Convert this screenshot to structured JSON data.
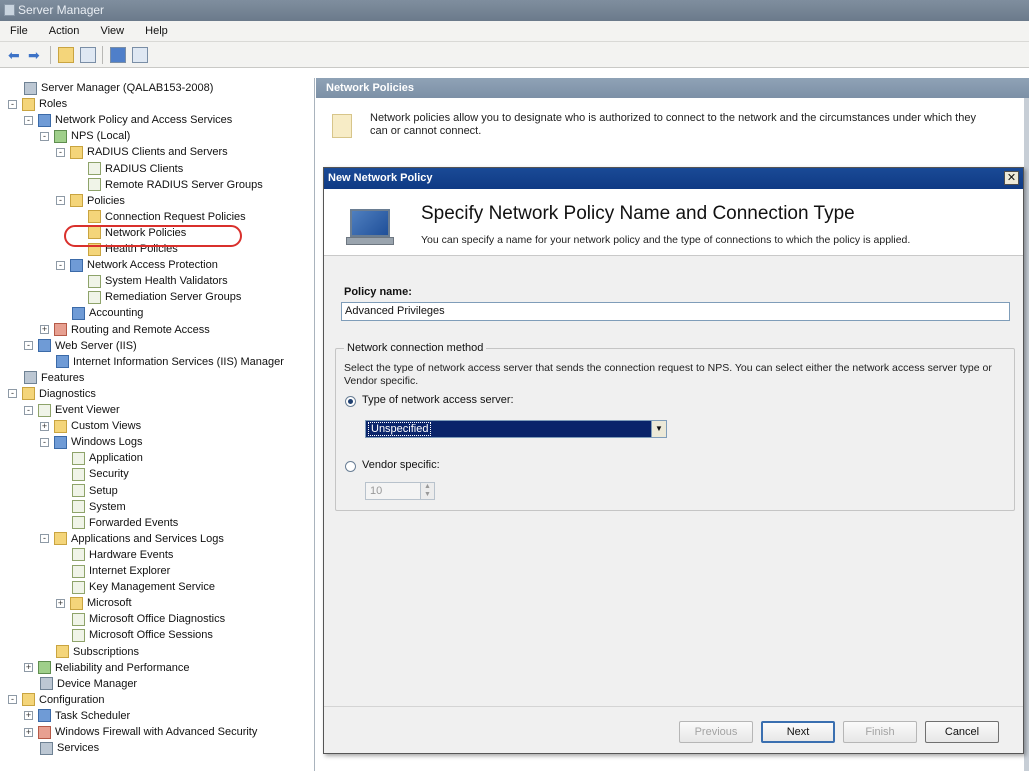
{
  "window": {
    "title": "Server Manager"
  },
  "menu": [
    "File",
    "Action",
    "View",
    "Help"
  ],
  "toolbar": {
    "back_icon": "back-arrow-icon",
    "forward_icon": "forward-arrow-icon"
  },
  "tree": [
    {
      "label": "Server Manager (QALAB153-2008)",
      "level": 0,
      "icon": "server"
    },
    {
      "label": "Roles",
      "level": 0,
      "icon": "folder",
      "exp": "-"
    },
    {
      "label": "Network Policy and Access Services",
      "level": 1,
      "icon": "blue",
      "exp": "-"
    },
    {
      "label": "NPS (Local)",
      "level": 2,
      "icon": "green",
      "exp": "-"
    },
    {
      "label": "RADIUS Clients and Servers",
      "level": 3,
      "icon": "folder",
      "exp": "-"
    },
    {
      "label": "RADIUS Clients",
      "level": 4,
      "icon": "log"
    },
    {
      "label": "Remote RADIUS Server Groups",
      "level": 4,
      "icon": "log"
    },
    {
      "label": "Policies",
      "level": 3,
      "icon": "folder",
      "exp": "-"
    },
    {
      "label": "Connection Request Policies",
      "level": 4,
      "icon": "folder"
    },
    {
      "label": "Network Policies",
      "level": 4,
      "icon": "folder"
    },
    {
      "label": "Health Policies",
      "level": 4,
      "icon": "folder"
    },
    {
      "label": "Network Access Protection",
      "level": 3,
      "icon": "blue",
      "exp": "-"
    },
    {
      "label": "System Health Validators",
      "level": 4,
      "icon": "log"
    },
    {
      "label": "Remediation Server Groups",
      "level": 4,
      "icon": "log"
    },
    {
      "label": "Accounting",
      "level": 3,
      "icon": "blue"
    },
    {
      "label": "Routing and Remote Access",
      "level": 2,
      "icon": "red",
      "exp": "+"
    },
    {
      "label": "Web Server (IIS)",
      "level": 1,
      "icon": "blue",
      "exp": "-"
    },
    {
      "label": "Internet Information Services (IIS) Manager",
      "level": 2,
      "icon": "blue"
    },
    {
      "label": "Features",
      "level": 0,
      "icon": "server"
    },
    {
      "label": "Diagnostics",
      "level": 0,
      "icon": "folder",
      "exp": "-"
    },
    {
      "label": "Event Viewer",
      "level": 1,
      "icon": "log",
      "exp": "-"
    },
    {
      "label": "Custom Views",
      "level": 2,
      "icon": "folder",
      "exp": "+"
    },
    {
      "label": "Windows Logs",
      "level": 2,
      "icon": "blue",
      "exp": "-"
    },
    {
      "label": "Application",
      "level": 3,
      "icon": "log"
    },
    {
      "label": "Security",
      "level": 3,
      "icon": "log"
    },
    {
      "label": "Setup",
      "level": 3,
      "icon": "log"
    },
    {
      "label": "System",
      "level": 3,
      "icon": "log"
    },
    {
      "label": "Forwarded Events",
      "level": 3,
      "icon": "log"
    },
    {
      "label": "Applications and Services Logs",
      "level": 2,
      "icon": "folder",
      "exp": "-"
    },
    {
      "label": "Hardware Events",
      "level": 3,
      "icon": "log"
    },
    {
      "label": "Internet Explorer",
      "level": 3,
      "icon": "log"
    },
    {
      "label": "Key Management Service",
      "level": 3,
      "icon": "log"
    },
    {
      "label": "Microsoft",
      "level": 3,
      "icon": "folder",
      "exp": "+"
    },
    {
      "label": "Microsoft Office Diagnostics",
      "level": 3,
      "icon": "log"
    },
    {
      "label": "Microsoft Office Sessions",
      "level": 3,
      "icon": "log"
    },
    {
      "label": "Subscriptions",
      "level": 2,
      "icon": "folder"
    },
    {
      "label": "Reliability and Performance",
      "level": 1,
      "icon": "green",
      "exp": "+"
    },
    {
      "label": "Device Manager",
      "level": 1,
      "icon": "server"
    },
    {
      "label": "Configuration",
      "level": 0,
      "icon": "folder",
      "exp": "-"
    },
    {
      "label": "Task Scheduler",
      "level": 1,
      "icon": "blue",
      "exp": "+"
    },
    {
      "label": "Windows Firewall with Advanced Security",
      "level": 1,
      "icon": "red",
      "exp": "+"
    },
    {
      "label": "Services",
      "level": 1,
      "icon": "server"
    }
  ],
  "selected_tree_item": "Network Policies",
  "right_pane": {
    "header": "Network Policies",
    "info": "Network policies allow you to designate who is authorized to connect to the network and the circumstances under which they can or cannot connect."
  },
  "dialog": {
    "title": "New Network Policy",
    "close": "✕",
    "heading": "Specify Network Policy Name and Connection Type",
    "subheading": "You can specify a name for your network policy and the type of connections to which the policy is applied.",
    "policy_name_label": "Policy name:",
    "policy_name_value": "Advanced Privileges",
    "group_label": "Network connection method",
    "group_desc": "Select the type of network access server that sends the connection request to NPS. You can select either the network access server type or Vendor specific.",
    "radio_type_label": "Type of network access server:",
    "type_selected": "Unspecified",
    "radio_vendor_label": "Vendor specific:",
    "vendor_value": "10",
    "buttons": {
      "previous": "Previous",
      "next": "Next",
      "finish": "Finish",
      "cancel": "Cancel"
    }
  }
}
